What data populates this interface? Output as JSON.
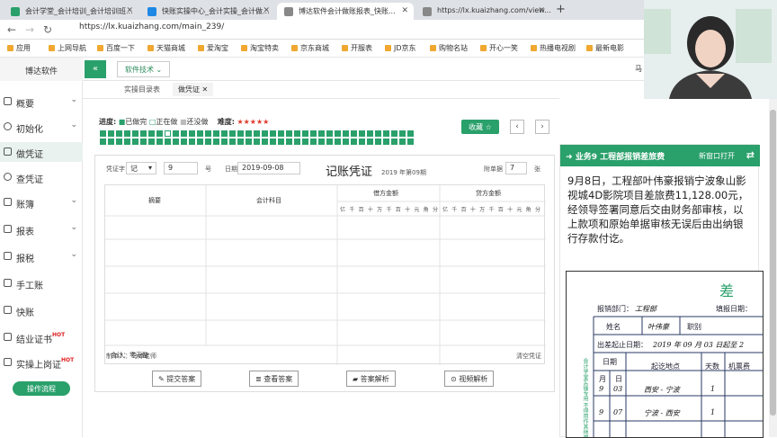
{
  "browser": {
    "tabs": [
      {
        "label": "会计学堂_会计培训_会计培训班..."
      },
      {
        "label": "快账实操中心_会计实操_会计做..."
      },
      {
        "label": "博达软件会计做账报表_快账..."
      },
      {
        "label": "https://lx.kuaizhang.com/view..."
      }
    ],
    "url": "https://lx.kuaizhang.com/main_239/",
    "bookmarks": [
      "应用",
      "上网导航",
      "百度一下",
      "天猫商城",
      "爱淘宝",
      "淘宝特卖",
      "京东商城",
      "开服表",
      "JD京东",
      "购物名站",
      "开心一笑",
      "热播电视剧",
      "最新电影"
    ]
  },
  "sidebar": {
    "brand": "博达软件",
    "items": [
      {
        "label": "概要",
        "icon": "document-icon"
      },
      {
        "label": "初始化",
        "icon": "gear-icon"
      },
      {
        "label": "做凭证",
        "icon": "pen-icon"
      },
      {
        "label": "查凭证",
        "icon": "search-icon"
      },
      {
        "label": "账簿",
        "icon": "book-icon"
      },
      {
        "label": "报表",
        "icon": "report-icon"
      },
      {
        "label": "报税",
        "icon": "tax-icon"
      },
      {
        "label": "手工账",
        "icon": "pen-icon"
      },
      {
        "label": "快账",
        "icon": "book-icon"
      },
      {
        "label": "结业证书",
        "icon": "certificate-icon"
      },
      {
        "label": "实操上岗证",
        "icon": "certificate-icon"
      }
    ],
    "hot_badge": "HOT",
    "flow_button": "操作流程"
  },
  "topbar": {
    "dropdown": "软件技术",
    "user": "马"
  },
  "subtabs": [
    "实操目录表",
    "做凭证"
  ],
  "progress": {
    "label": "进度:",
    "done": "已做完",
    "doing": "正在做",
    "todo": "还没做",
    "difficulty_label": "难度:",
    "difficulty": "★★★★★",
    "favorite": "收藏 ☆",
    "prev": "‹",
    "next": "›"
  },
  "voucher": {
    "word_label": "凭证字",
    "word": "记",
    "number": "9",
    "number_unit": "号",
    "date_label": "日期",
    "date": "2019-09-08",
    "title": "记账凭证",
    "period": "2019 年第09期",
    "attach_label": "附单据",
    "attach": "7",
    "attach_unit": "张",
    "col_summary": "摘要",
    "col_account": "会计科目",
    "col_debit": "借方金额",
    "col_credit": "贷方金额",
    "digits": [
      "亿",
      "千",
      "百",
      "十",
      "万",
      "千",
      "百",
      "十",
      "元",
      "角",
      "分"
    ],
    "total": "合计：零元整",
    "maker": "制单人：马婷老师",
    "clear": "清空凭证"
  },
  "buttons": {
    "submit": "提交答案",
    "view": "查看答案",
    "analysis": "答案解析",
    "video": "视频解析"
  },
  "task": {
    "title": "业务9 工程部报销差旅费",
    "new_window": "新窗口打开",
    "text": "9月8日，工程部叶伟豪报销宁波象山影视城4D影院项目差旅费11,128.00元，经领导签署同意后交由财务部审核，以上款项和原始单据审核无误后由出纳银行存款付讫。"
  },
  "form": {
    "dept_label": "报销部门：",
    "dept": "工程部",
    "date_label": "填报日期：",
    "name_label": "姓名",
    "name": "叶伟豪",
    "position_label": "职别",
    "start_label": "出差起止日期：",
    "start": "2019 年 09 月 03 日起至 2",
    "date_col": "日期",
    "month_col": "月",
    "day_col": "日",
    "place_col": "起讫地点",
    "days_col": "天数",
    "ticket_col": "机票费",
    "rows": [
      {
        "month": "9",
        "day": "03",
        "place": "西安 - 宁波",
        "days": "1"
      },
      {
        "month": "9",
        "day": "07",
        "place": "宁波 - 西安",
        "days": "1"
      }
    ],
    "side_stamp": "会计学堂实操专用 不得用作其他用途"
  }
}
